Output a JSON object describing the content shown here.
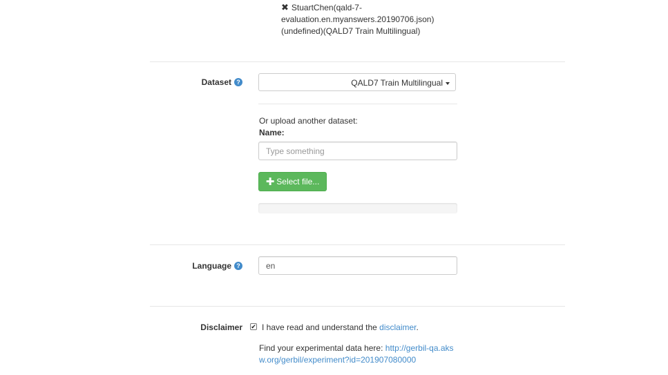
{
  "answer_file": {
    "remove_icon": "close-x-icon",
    "remove_glyph": "✖",
    "text": "StuartChen(qald-7-evaluation.en.myanswers.20190706.json)(undefined)(QALD7 Train Multilingual)"
  },
  "dataset": {
    "label": "Dataset",
    "help_glyph": "?",
    "selected": "QALD7 Train Multilingual",
    "upload_prompt": "Or upload another dataset:",
    "name_label": "Name:",
    "name_placeholder": "Type something",
    "name_value": "",
    "select_file_label": "Select file...",
    "upload_progress": 0
  },
  "language": {
    "label": "Language",
    "help_glyph": "?",
    "value": "en"
  },
  "disclaimer": {
    "label": "Disclaimer",
    "checked": true,
    "check_glyph": "✔",
    "text": "I have read and understand the",
    "link_text": "disclaimer",
    "after_link": "."
  },
  "experiment": {
    "text": "Find your experimental data here:",
    "url": "http://gerbil-qa.aksw.org/gerbil/experiment?id=201907080000"
  },
  "colors": {
    "accent": "#428bca",
    "success": "#5cb85c",
    "text": "#333333",
    "border": "#cccccc"
  }
}
